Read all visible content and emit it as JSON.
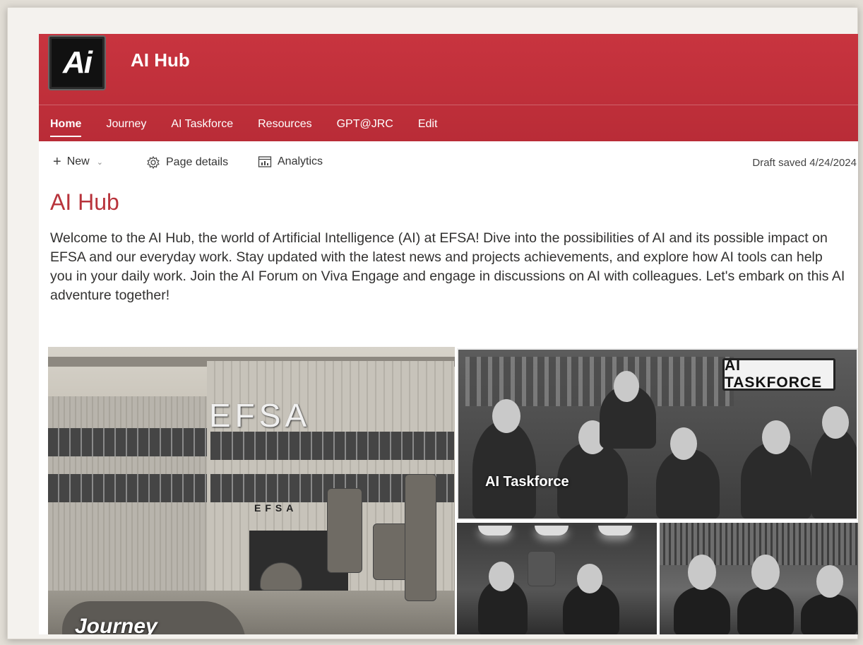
{
  "site": {
    "logo_text": "Ai",
    "title": "AI Hub"
  },
  "nav": {
    "items": [
      {
        "label": "Home",
        "active": true
      },
      {
        "label": "Journey"
      },
      {
        "label": "AI Taskforce"
      },
      {
        "label": "Resources"
      },
      {
        "label": "GPT@JRC"
      },
      {
        "label": "Edit"
      }
    ]
  },
  "toolbar": {
    "new_label": "New",
    "page_details_label": "Page details",
    "analytics_label": "Analytics",
    "draft_status": "Draft saved 4/24/2024"
  },
  "content": {
    "page_title": "AI Hub",
    "intro": "Welcome to the AI Hub, the world of Artificial Intelligence (AI) at EFSA! Dive into the possibilities of AI and its possible impact on EFSA and our everyday work. Stay updated with the latest news and projects achievements, and explore how AI tools can help you in your daily work. Join the AI Forum on Viva Engage and engage in discussions on AI with colleagues. Let's embark on this AI adventure together!"
  },
  "hero": {
    "journey_label": "Journey",
    "journey_sign_big": "EFSA",
    "journey_sign_small": "EFSA",
    "taskforce_label": "AI Taskforce",
    "taskforce_sign": "AI TASKFORCE"
  },
  "icons": {
    "new": "plus-icon",
    "page_details": "gear-icon",
    "analytics": "analytics-icon"
  },
  "colors": {
    "brand": "#c3323d",
    "title": "#b8333b"
  }
}
